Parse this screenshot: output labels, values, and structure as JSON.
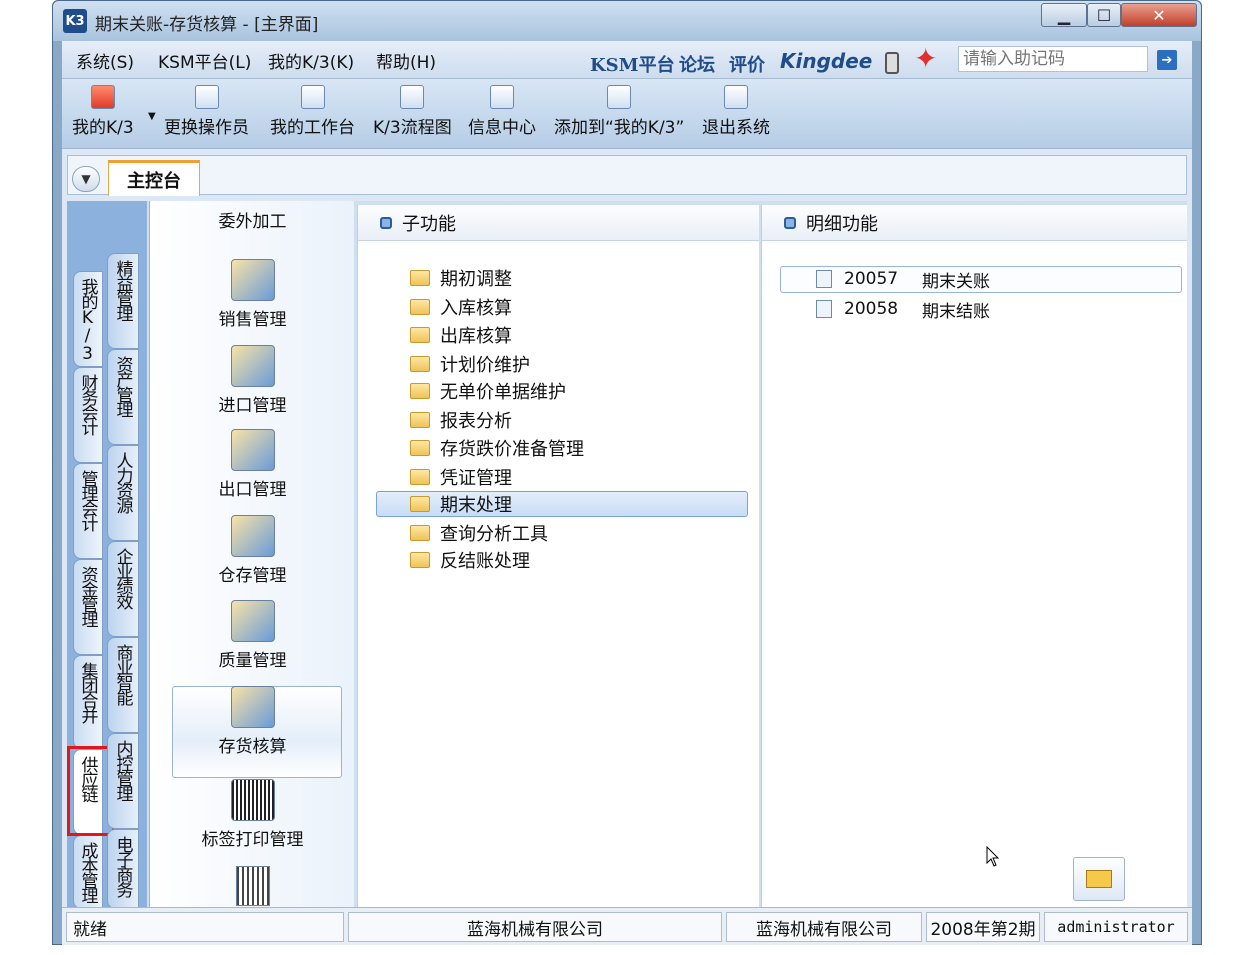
{
  "window": {
    "title": "期末关账-存货核算 - [主界面]",
    "app_icon": "K3"
  },
  "menu": {
    "items": [
      "系统(S)",
      "KSM平台(L)",
      "我的K/3(K)",
      "帮助(H)"
    ]
  },
  "toplinks": {
    "ksm": "KSM平台",
    "forum": "论坛",
    "review": "评价",
    "brand": "Kingdee"
  },
  "memo": {
    "placeholder": "请输入助记码"
  },
  "toolbar": {
    "items": [
      "我的K/3",
      "更换操作员",
      "我的工作台",
      "K/3流程图",
      "信息中心",
      "添加到“我的K/3”",
      "退出系统"
    ]
  },
  "tabs": {
    "main": "主控台"
  },
  "vtabs": {
    "col1": [
      "我的K/3",
      "财务会计",
      "管理会计",
      "资金管理",
      "集团合并",
      "供应链",
      "成本管理"
    ],
    "col2": [
      "精益管理",
      "资产管理",
      "人力资源",
      "企业绩效",
      "商业智能",
      "内控管理",
      "电子商务"
    ]
  },
  "modules": [
    "委外加工",
    "销售管理",
    "进口管理",
    "出口管理",
    "仓存管理",
    "质量管理",
    "存货核算",
    "标签打印管理"
  ],
  "sub_panel": {
    "title": "子功能",
    "folders": [
      "期初调整",
      "入库核算",
      "出库核算",
      "计划价维护",
      "无单价单据维护",
      "报表分析",
      "存货跌价准备管理",
      "凭证管理",
      "期末处理",
      "查询分析工具",
      "反结账处理"
    ],
    "selected": "期末处理"
  },
  "det_panel": {
    "title": "明细功能",
    "items": [
      {
        "code": "20057",
        "name": "期末关账"
      },
      {
        "code": "20058",
        "name": "期末结账"
      }
    ]
  },
  "status": {
    "ready": "就绪",
    "company1": "蓝海机械有限公司",
    "company2": "蓝海机械有限公司",
    "period": "2008年第2期",
    "user": "administrator"
  },
  "icons": [
    "app-icon",
    "phone-icon",
    "star-icon",
    "go-arrow-icon",
    "folder-icon",
    "document-icon",
    "mail-icon",
    "chevron-down-icon",
    "scroll-up-icon",
    "scroll-down-icon"
  ],
  "colors": {
    "highlight_box": "#e0181e",
    "selection": "#c7dcf5",
    "brand": "#1f4d8a"
  }
}
